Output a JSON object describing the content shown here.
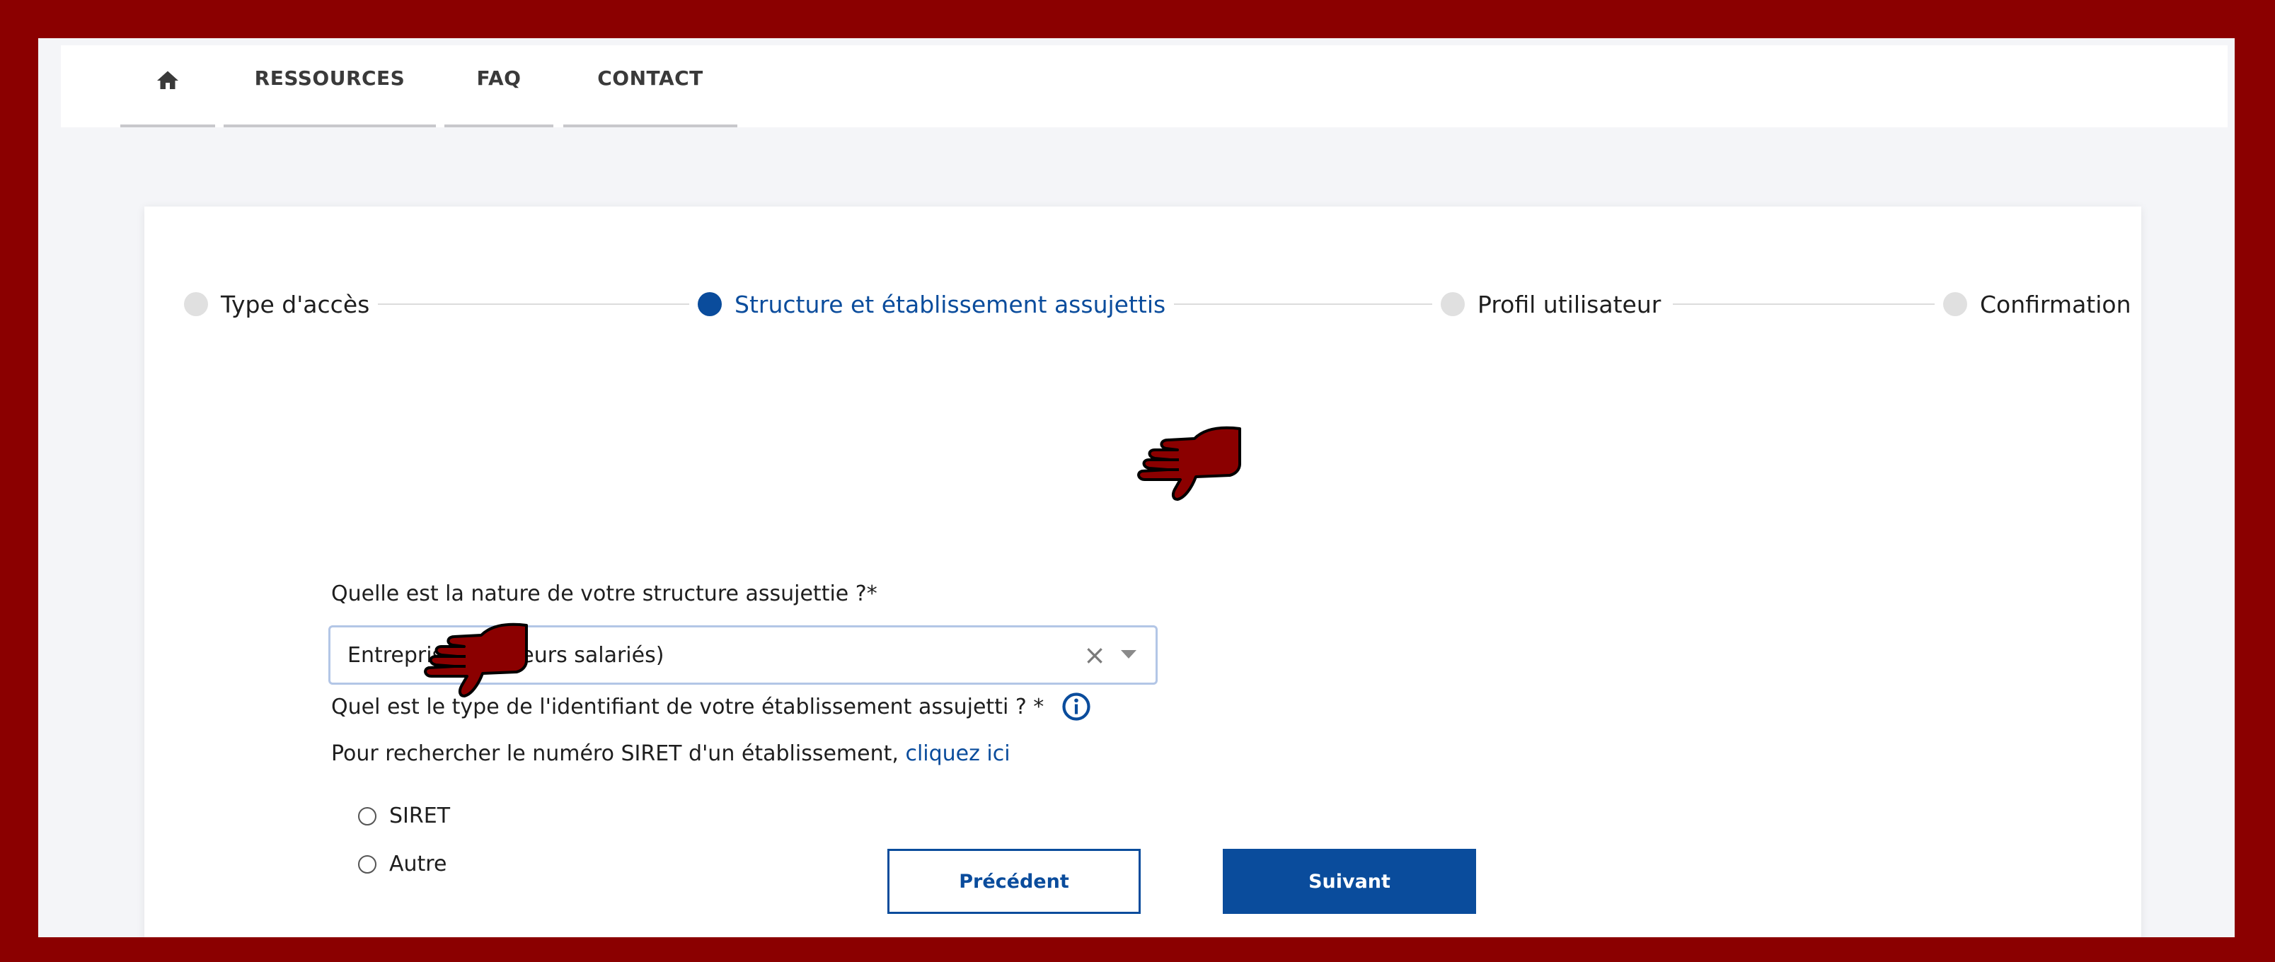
{
  "nav": {
    "home_icon": "home-icon",
    "items": [
      {
        "label": "RESSOURCES"
      },
      {
        "label": "FAQ"
      },
      {
        "label": "CONTACT"
      }
    ]
  },
  "stepper": {
    "steps": [
      {
        "label": "Type d'accès",
        "state": "inactive"
      },
      {
        "label": "Structure et établissement assujettis",
        "state": "active"
      },
      {
        "label": "Profil utilisateur",
        "state": "inactive"
      },
      {
        "label": "Confirmation",
        "state": "inactive"
      }
    ]
  },
  "form": {
    "structure_question": "Quelle est la nature de votre structure assujettie ?*",
    "structure_value": "Entreprise (plusieurs salariés)",
    "identifier_question": "Quel est le type de l'identifiant de votre établissement assujetti ? *",
    "siret_help_text": "Pour rechercher le numéro SIRET d'un établissement,",
    "siret_help_link": "cliquez ici",
    "radio_options": [
      {
        "label": "SIRET",
        "checked": false
      },
      {
        "label": "Autre",
        "checked": false
      }
    ]
  },
  "buttons": {
    "previous": "Précédent",
    "next": "Suivant"
  },
  "colors": {
    "accent": "#0a4c9c",
    "frame": "#8b0000",
    "annotation_hand": "#8b0000"
  }
}
